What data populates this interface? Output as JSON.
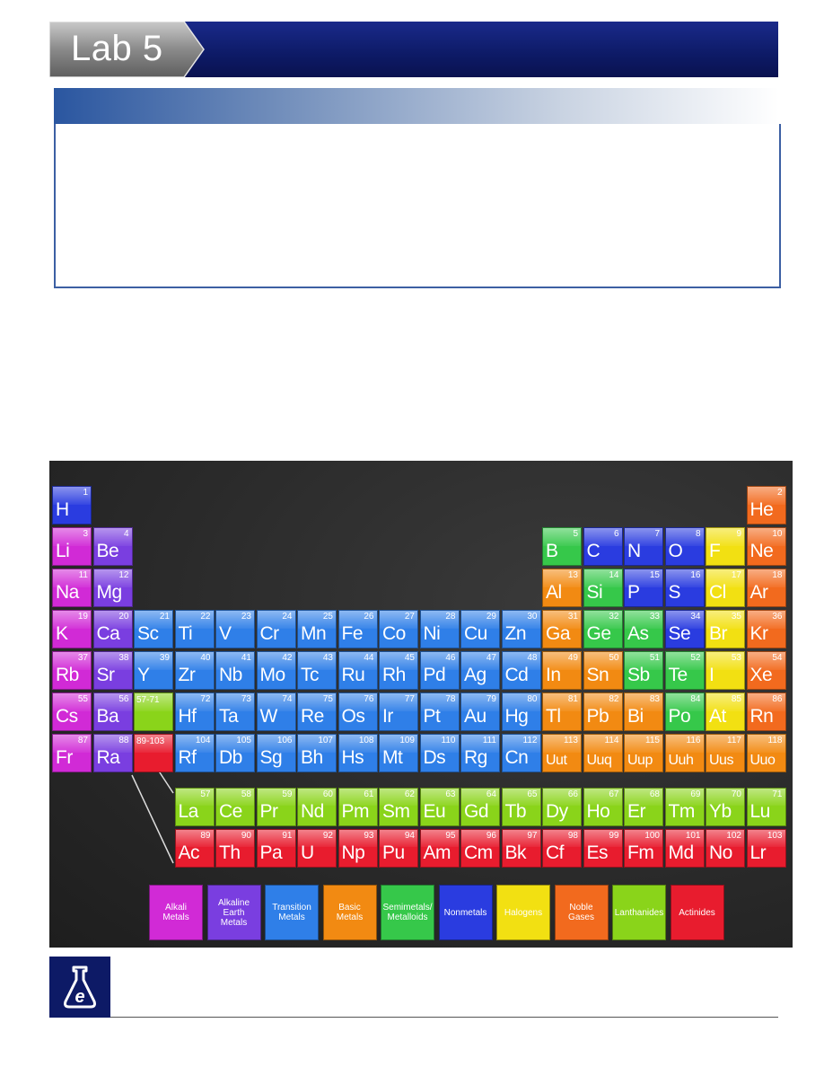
{
  "header": {
    "title": "Lab 5"
  },
  "colors": {
    "alkali": "#d12ad6",
    "alkaline": "#7a3ee0",
    "transition": "#2f7fe8",
    "basic": "#f28a12",
    "semimetal": "#36c84a",
    "nonmetal": "#2a3ce0",
    "halogen": "#f2e012",
    "noble": "#f26a1e",
    "lanthanide": "#8ad41a",
    "actinide": "#e81c2e"
  },
  "periodic_table": {
    "elements": [
      {
        "s": "H",
        "n": "1",
        "r": 0,
        "c": 0,
        "t": "nonmetal"
      },
      {
        "s": "He",
        "n": "2",
        "r": 0,
        "c": 17,
        "t": "noble"
      },
      {
        "s": "Li",
        "n": "3",
        "r": 1,
        "c": 0,
        "t": "alkali"
      },
      {
        "s": "Be",
        "n": "4",
        "r": 1,
        "c": 1,
        "t": "alkaline"
      },
      {
        "s": "B",
        "n": "5",
        "r": 1,
        "c": 12,
        "t": "semimetal"
      },
      {
        "s": "C",
        "n": "6",
        "r": 1,
        "c": 13,
        "t": "nonmetal"
      },
      {
        "s": "N",
        "n": "7",
        "r": 1,
        "c": 14,
        "t": "nonmetal"
      },
      {
        "s": "O",
        "n": "8",
        "r": 1,
        "c": 15,
        "t": "nonmetal"
      },
      {
        "s": "F",
        "n": "9",
        "r": 1,
        "c": 16,
        "t": "halogen"
      },
      {
        "s": "Ne",
        "n": "10",
        "r": 1,
        "c": 17,
        "t": "noble"
      },
      {
        "s": "Na",
        "n": "11",
        "r": 2,
        "c": 0,
        "t": "alkali"
      },
      {
        "s": "Mg",
        "n": "12",
        "r": 2,
        "c": 1,
        "t": "alkaline"
      },
      {
        "s": "Al",
        "n": "13",
        "r": 2,
        "c": 12,
        "t": "basic"
      },
      {
        "s": "Si",
        "n": "14",
        "r": 2,
        "c": 13,
        "t": "semimetal"
      },
      {
        "s": "P",
        "n": "15",
        "r": 2,
        "c": 14,
        "t": "nonmetal"
      },
      {
        "s": "S",
        "n": "16",
        "r": 2,
        "c": 15,
        "t": "nonmetal"
      },
      {
        "s": "Cl",
        "n": "17",
        "r": 2,
        "c": 16,
        "t": "halogen"
      },
      {
        "s": "Ar",
        "n": "18",
        "r": 2,
        "c": 17,
        "t": "noble"
      },
      {
        "s": "K",
        "n": "19",
        "r": 3,
        "c": 0,
        "t": "alkali"
      },
      {
        "s": "Ca",
        "n": "20",
        "r": 3,
        "c": 1,
        "t": "alkaline"
      },
      {
        "s": "Sc",
        "n": "21",
        "r": 3,
        "c": 2,
        "t": "transition"
      },
      {
        "s": "Ti",
        "n": "22",
        "r": 3,
        "c": 3,
        "t": "transition"
      },
      {
        "s": "V",
        "n": "23",
        "r": 3,
        "c": 4,
        "t": "transition"
      },
      {
        "s": "Cr",
        "n": "24",
        "r": 3,
        "c": 5,
        "t": "transition"
      },
      {
        "s": "Mn",
        "n": "25",
        "r": 3,
        "c": 6,
        "t": "transition"
      },
      {
        "s": "Fe",
        "n": "26",
        "r": 3,
        "c": 7,
        "t": "transition"
      },
      {
        "s": "Co",
        "n": "27",
        "r": 3,
        "c": 8,
        "t": "transition"
      },
      {
        "s": "Ni",
        "n": "28",
        "r": 3,
        "c": 9,
        "t": "transition"
      },
      {
        "s": "Cu",
        "n": "29",
        "r": 3,
        "c": 10,
        "t": "transition"
      },
      {
        "s": "Zn",
        "n": "30",
        "r": 3,
        "c": 11,
        "t": "transition"
      },
      {
        "s": "Ga",
        "n": "31",
        "r": 3,
        "c": 12,
        "t": "basic"
      },
      {
        "s": "Ge",
        "n": "32",
        "r": 3,
        "c": 13,
        "t": "semimetal"
      },
      {
        "s": "As",
        "n": "33",
        "r": 3,
        "c": 14,
        "t": "semimetal"
      },
      {
        "s": "Se",
        "n": "34",
        "r": 3,
        "c": 15,
        "t": "nonmetal"
      },
      {
        "s": "Br",
        "n": "35",
        "r": 3,
        "c": 16,
        "t": "halogen"
      },
      {
        "s": "Kr",
        "n": "36",
        "r": 3,
        "c": 17,
        "t": "noble"
      },
      {
        "s": "Rb",
        "n": "37",
        "r": 4,
        "c": 0,
        "t": "alkali"
      },
      {
        "s": "Sr",
        "n": "38",
        "r": 4,
        "c": 1,
        "t": "alkaline"
      },
      {
        "s": "Y",
        "n": "39",
        "r": 4,
        "c": 2,
        "t": "transition"
      },
      {
        "s": "Zr",
        "n": "40",
        "r": 4,
        "c": 3,
        "t": "transition"
      },
      {
        "s": "Nb",
        "n": "41",
        "r": 4,
        "c": 4,
        "t": "transition"
      },
      {
        "s": "Mo",
        "n": "42",
        "r": 4,
        "c": 5,
        "t": "transition"
      },
      {
        "s": "Tc",
        "n": "43",
        "r": 4,
        "c": 6,
        "t": "transition"
      },
      {
        "s": "Ru",
        "n": "44",
        "r": 4,
        "c": 7,
        "t": "transition"
      },
      {
        "s": "Rh",
        "n": "45",
        "r": 4,
        "c": 8,
        "t": "transition"
      },
      {
        "s": "Pd",
        "n": "46",
        "r": 4,
        "c": 9,
        "t": "transition"
      },
      {
        "s": "Ag",
        "n": "47",
        "r": 4,
        "c": 10,
        "t": "transition"
      },
      {
        "s": "Cd",
        "n": "48",
        "r": 4,
        "c": 11,
        "t": "transition"
      },
      {
        "s": "In",
        "n": "49",
        "r": 4,
        "c": 12,
        "t": "basic"
      },
      {
        "s": "Sn",
        "n": "50",
        "r": 4,
        "c": 13,
        "t": "basic"
      },
      {
        "s": "Sb",
        "n": "51",
        "r": 4,
        "c": 14,
        "t": "semimetal"
      },
      {
        "s": "Te",
        "n": "52",
        "r": 4,
        "c": 15,
        "t": "semimetal"
      },
      {
        "s": "I",
        "n": "53",
        "r": 4,
        "c": 16,
        "t": "halogen"
      },
      {
        "s": "Xe",
        "n": "54",
        "r": 4,
        "c": 17,
        "t": "noble"
      },
      {
        "s": "Cs",
        "n": "55",
        "r": 5,
        "c": 0,
        "t": "alkali"
      },
      {
        "s": "Ba",
        "n": "56",
        "r": 5,
        "c": 1,
        "t": "alkaline"
      },
      {
        "s": "",
        "n": "57-71",
        "r": 5,
        "c": 2,
        "t": "lanthanide",
        "ph": true
      },
      {
        "s": "Hf",
        "n": "72",
        "r": 5,
        "c": 3,
        "t": "transition"
      },
      {
        "s": "Ta",
        "n": "73",
        "r": 5,
        "c": 4,
        "t": "transition"
      },
      {
        "s": "W",
        "n": "74",
        "r": 5,
        "c": 5,
        "t": "transition"
      },
      {
        "s": "Re",
        "n": "75",
        "r": 5,
        "c": 6,
        "t": "transition"
      },
      {
        "s": "Os",
        "n": "76",
        "r": 5,
        "c": 7,
        "t": "transition"
      },
      {
        "s": "Ir",
        "n": "77",
        "r": 5,
        "c": 8,
        "t": "transition"
      },
      {
        "s": "Pt",
        "n": "78",
        "r": 5,
        "c": 9,
        "t": "transition"
      },
      {
        "s": "Au",
        "n": "79",
        "r": 5,
        "c": 10,
        "t": "transition"
      },
      {
        "s": "Hg",
        "n": "80",
        "r": 5,
        "c": 11,
        "t": "transition"
      },
      {
        "s": "Tl",
        "n": "81",
        "r": 5,
        "c": 12,
        "t": "basic"
      },
      {
        "s": "Pb",
        "n": "82",
        "r": 5,
        "c": 13,
        "t": "basic"
      },
      {
        "s": "Bi",
        "n": "83",
        "r": 5,
        "c": 14,
        "t": "basic"
      },
      {
        "s": "Po",
        "n": "84",
        "r": 5,
        "c": 15,
        "t": "semimetal"
      },
      {
        "s": "At",
        "n": "85",
        "r": 5,
        "c": 16,
        "t": "halogen"
      },
      {
        "s": "Rn",
        "n": "86",
        "r": 5,
        "c": 17,
        "t": "noble"
      },
      {
        "s": "Fr",
        "n": "87",
        "r": 6,
        "c": 0,
        "t": "alkali"
      },
      {
        "s": "Ra",
        "n": "88",
        "r": 6,
        "c": 1,
        "t": "alkaline"
      },
      {
        "s": "",
        "n": "89-103",
        "r": 6,
        "c": 2,
        "t": "actinide",
        "ph": true
      },
      {
        "s": "Rf",
        "n": "104",
        "r": 6,
        "c": 3,
        "t": "transition"
      },
      {
        "s": "Db",
        "n": "105",
        "r": 6,
        "c": 4,
        "t": "transition"
      },
      {
        "s": "Sg",
        "n": "106",
        "r": 6,
        "c": 5,
        "t": "transition"
      },
      {
        "s": "Bh",
        "n": "107",
        "r": 6,
        "c": 6,
        "t": "transition"
      },
      {
        "s": "Hs",
        "n": "108",
        "r": 6,
        "c": 7,
        "t": "transition"
      },
      {
        "s": "Mt",
        "n": "109",
        "r": 6,
        "c": 8,
        "t": "transition"
      },
      {
        "s": "Ds",
        "n": "110",
        "r": 6,
        "c": 9,
        "t": "transition"
      },
      {
        "s": "Rg",
        "n": "111",
        "r": 6,
        "c": 10,
        "t": "transition"
      },
      {
        "s": "Cn",
        "n": "112",
        "r": 6,
        "c": 11,
        "t": "transition"
      },
      {
        "s": "Uut",
        "n": "113",
        "r": 6,
        "c": 12,
        "t": "basic",
        "small": true
      },
      {
        "s": "Uuq",
        "n": "114",
        "r": 6,
        "c": 13,
        "t": "basic",
        "small": true
      },
      {
        "s": "Uup",
        "n": "115",
        "r": 6,
        "c": 14,
        "t": "basic",
        "small": true
      },
      {
        "s": "Uuh",
        "n": "116",
        "r": 6,
        "c": 15,
        "t": "basic",
        "small": true
      },
      {
        "s": "Uus",
        "n": "117",
        "r": 6,
        "c": 16,
        "t": "basic",
        "small": true
      },
      {
        "s": "Uuo",
        "n": "118",
        "r": 6,
        "c": 17,
        "t": "basic",
        "small": true
      },
      {
        "s": "La",
        "n": "57",
        "r": 7.3,
        "c": 3,
        "t": "lanthanide"
      },
      {
        "s": "Ce",
        "n": "58",
        "r": 7.3,
        "c": 4,
        "t": "lanthanide"
      },
      {
        "s": "Pr",
        "n": "59",
        "r": 7.3,
        "c": 5,
        "t": "lanthanide"
      },
      {
        "s": "Nd",
        "n": "60",
        "r": 7.3,
        "c": 6,
        "t": "lanthanide"
      },
      {
        "s": "Pm",
        "n": "61",
        "r": 7.3,
        "c": 7,
        "t": "lanthanide"
      },
      {
        "s": "Sm",
        "n": "62",
        "r": 7.3,
        "c": 8,
        "t": "lanthanide"
      },
      {
        "s": "Eu",
        "n": "63",
        "r": 7.3,
        "c": 9,
        "t": "lanthanide"
      },
      {
        "s": "Gd",
        "n": "64",
        "r": 7.3,
        "c": 10,
        "t": "lanthanide"
      },
      {
        "s": "Tb",
        "n": "65",
        "r": 7.3,
        "c": 11,
        "t": "lanthanide"
      },
      {
        "s": "Dy",
        "n": "66",
        "r": 7.3,
        "c": 12,
        "t": "lanthanide"
      },
      {
        "s": "Ho",
        "n": "67",
        "r": 7.3,
        "c": 13,
        "t": "lanthanide"
      },
      {
        "s": "Er",
        "n": "68",
        "r": 7.3,
        "c": 14,
        "t": "lanthanide"
      },
      {
        "s": "Tm",
        "n": "69",
        "r": 7.3,
        "c": 15,
        "t": "lanthanide"
      },
      {
        "s": "Yb",
        "n": "70",
        "r": 7.3,
        "c": 16,
        "t": "lanthanide"
      },
      {
        "s": "Lu",
        "n": "71",
        "r": 7.3,
        "c": 17,
        "t": "lanthanide"
      },
      {
        "s": "Ac",
        "n": "89",
        "r": 8.3,
        "c": 3,
        "t": "actinide"
      },
      {
        "s": "Th",
        "n": "90",
        "r": 8.3,
        "c": 4,
        "t": "actinide"
      },
      {
        "s": "Pa",
        "n": "91",
        "r": 8.3,
        "c": 5,
        "t": "actinide"
      },
      {
        "s": "U",
        "n": "92",
        "r": 8.3,
        "c": 6,
        "t": "actinide"
      },
      {
        "s": "Np",
        "n": "93",
        "r": 8.3,
        "c": 7,
        "t": "actinide"
      },
      {
        "s": "Pu",
        "n": "94",
        "r": 8.3,
        "c": 8,
        "t": "actinide"
      },
      {
        "s": "Am",
        "n": "95",
        "r": 8.3,
        "c": 9,
        "t": "actinide"
      },
      {
        "s": "Cm",
        "n": "96",
        "r": 8.3,
        "c": 10,
        "t": "actinide"
      },
      {
        "s": "Bk",
        "n": "97",
        "r": 8.3,
        "c": 11,
        "t": "actinide"
      },
      {
        "s": "Cf",
        "n": "98",
        "r": 8.3,
        "c": 12,
        "t": "actinide"
      },
      {
        "s": "Es",
        "n": "99",
        "r": 8.3,
        "c": 13,
        "t": "actinide"
      },
      {
        "s": "Fm",
        "n": "100",
        "r": 8.3,
        "c": 14,
        "t": "actinide"
      },
      {
        "s": "Md",
        "n": "101",
        "r": 8.3,
        "c": 15,
        "t": "actinide"
      },
      {
        "s": "No",
        "n": "102",
        "r": 8.3,
        "c": 16,
        "t": "actinide"
      },
      {
        "s": "Lr",
        "n": "103",
        "r": 8.3,
        "c": 17,
        "t": "actinide"
      }
    ],
    "legend": [
      {
        "label": "Alkali Metals",
        "t": "alkali"
      },
      {
        "label": "Alkaline Earth Metals",
        "t": "alkaline"
      },
      {
        "label": "Transition Metals",
        "t": "transition"
      },
      {
        "label": "Basic Metals",
        "t": "basic"
      },
      {
        "label": "Semimetals/ Metalloids",
        "t": "semimetal"
      },
      {
        "label": "Nonmetals",
        "t": "nonmetal"
      },
      {
        "label": "Halogens",
        "t": "halogen"
      },
      {
        "label": "Noble Gases",
        "t": "noble"
      },
      {
        "label": "Lanthanides",
        "t": "lanthanide"
      },
      {
        "label": "Actinides",
        "t": "actinide"
      }
    ]
  },
  "footer": {
    "logo_icon": "flask-e-icon"
  }
}
